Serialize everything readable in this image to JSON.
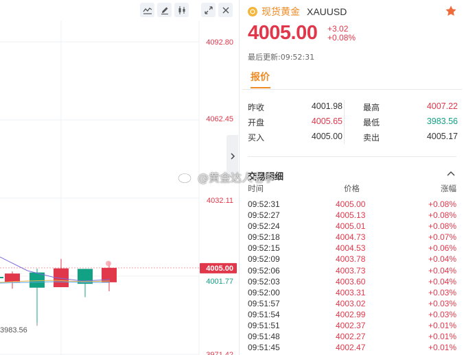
{
  "toolbar": {
    "icons": [
      "line-chart-icon",
      "pen-icon",
      "candlestick-icon",
      "expand-icon",
      "close-icon"
    ]
  },
  "chart": {
    "price_axis": [
      "4092.80",
      "4062.45",
      "4032.11",
      "4001.77",
      "3971.42"
    ],
    "current_price_tag": "4005.00",
    "low_marker": "3983.56",
    "colors": {
      "up": "#e0374a",
      "down": "#11a184",
      "ma1": "#7b6cd9",
      "ma2": "#e8b64b",
      "ma3": "#5aa8e6"
    },
    "candles": [
      {
        "open": 4001.5,
        "close": 4001.5,
        "high": 4001.5,
        "low": 4001.5,
        "dir": "down",
        "partial": true
      },
      {
        "open": 4002.8,
        "close": 3999.5,
        "high": 4003.6,
        "low": 3996.9,
        "dir": "up"
      },
      {
        "open": 4003.2,
        "close": 3997.3,
        "high": 4004.7,
        "low": 3983.56,
        "dir": "down"
      },
      {
        "open": 3997.5,
        "close": 4004.8,
        "high": 4008.5,
        "low": 3997.5,
        "dir": "up"
      },
      {
        "open": 4004.6,
        "close": 3998.8,
        "high": 4004.6,
        "low": 3993.6,
        "dir": "down"
      },
      {
        "open": 3999.4,
        "close": 4005.0,
        "high": 4007.22,
        "low": 3995.9,
        "dir": "up"
      }
    ]
  },
  "watermark": {
    "text": "@黄金达人老李"
  },
  "info": {
    "name": "现货黄金",
    "symbol": "XAUUSD",
    "price": "4005.00",
    "change": "+3.02",
    "change_pct": "+0.08%",
    "updated": "最后更新:09:52:31",
    "tab": "报价",
    "quote": [
      {
        "l_label": "昨收",
        "l_val": "4001.98",
        "l_cls": "dark",
        "r_label": "最高",
        "r_val": "4007.22",
        "r_cls": "red"
      },
      {
        "l_label": "开盘",
        "l_val": "4005.65",
        "l_cls": "red",
        "r_label": "最低",
        "r_val": "3983.56",
        "r_cls": "green"
      },
      {
        "l_label": "买入",
        "l_val": "4005.00",
        "l_cls": "dark",
        "r_label": "卖出",
        "r_val": "4005.17",
        "r_cls": "dark"
      }
    ],
    "trades_title": "交易明细",
    "trades_headers": {
      "time": "时间",
      "price": "价格",
      "change": "涨幅"
    },
    "trades": [
      {
        "time": "09:52:31",
        "price": "4005.00",
        "change": "+0.08%"
      },
      {
        "time": "09:52:27",
        "price": "4005.13",
        "change": "+0.08%"
      },
      {
        "time": "09:52:24",
        "price": "4005.01",
        "change": "+0.08%"
      },
      {
        "time": "09:52:18",
        "price": "4004.73",
        "change": "+0.07%"
      },
      {
        "time": "09:52:15",
        "price": "4004.53",
        "change": "+0.06%"
      },
      {
        "time": "09:52:09",
        "price": "4003.78",
        "change": "+0.04%"
      },
      {
        "time": "09:52:06",
        "price": "4003.73",
        "change": "+0.04%"
      },
      {
        "time": "09:52:03",
        "price": "4003.60",
        "change": "+0.04%"
      },
      {
        "time": "09:52:00",
        "price": "4003.31",
        "change": "+0.03%"
      },
      {
        "time": "09:51:57",
        "price": "4003.02",
        "change": "+0.03%"
      },
      {
        "time": "09:51:54",
        "price": "4002.99",
        "change": "+0.03%"
      },
      {
        "time": "09:51:51",
        "price": "4002.37",
        "change": "+0.01%"
      },
      {
        "time": "09:51:48",
        "price": "4002.27",
        "change": "+0.01%"
      },
      {
        "time": "09:51:45",
        "price": "4002.47",
        "change": "+0.01%"
      }
    ]
  }
}
